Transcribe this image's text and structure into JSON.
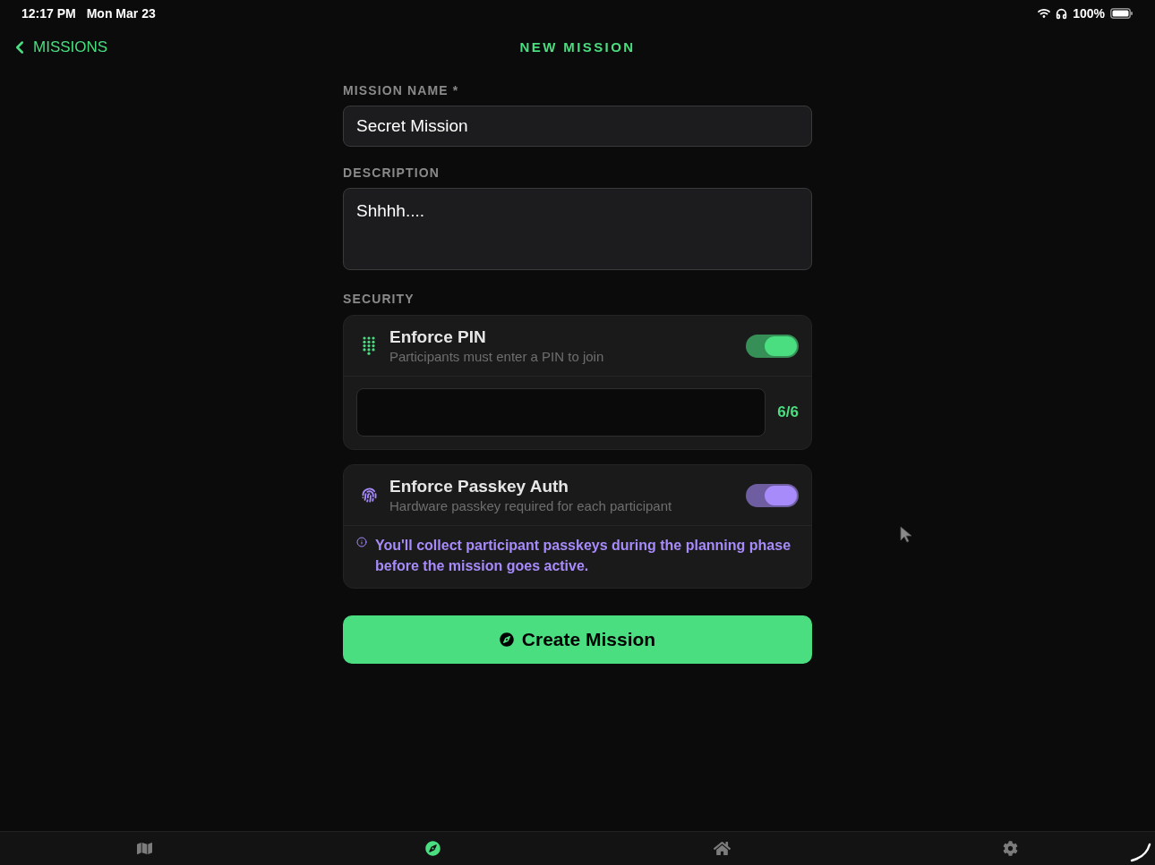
{
  "status_bar": {
    "time": "12:17 PM",
    "date": "Mon Mar 23",
    "battery": "100%"
  },
  "nav": {
    "back": "MISSIONS",
    "title": "NEW MISSION"
  },
  "form": {
    "name": {
      "label": "MISSION NAME *",
      "value": "Secret Mission"
    },
    "description": {
      "label": "DESCRIPTION",
      "value": "Shhhh...."
    }
  },
  "security": {
    "label": "SECURITY",
    "options": [
      {
        "kind": "pin",
        "title": "Enforce PIN",
        "subtitle": "Participants must enter a PIN to join",
        "on": true,
        "color": "#4ade80",
        "counter": "6/6"
      },
      {
        "kind": "passkey",
        "title": "Enforce Passkey Auth",
        "subtitle": "Hardware passkey required for each participant",
        "on": true,
        "color": "#a78bfa",
        "note": "You'll collect participant passkeys during the planning phase before the mission goes active."
      }
    ]
  },
  "create_button": "Create Mission",
  "tab_bar": [
    {
      "selected": false
    },
    {
      "selected": true
    },
    {
      "selected": false
    },
    {
      "selected": false
    }
  ]
}
